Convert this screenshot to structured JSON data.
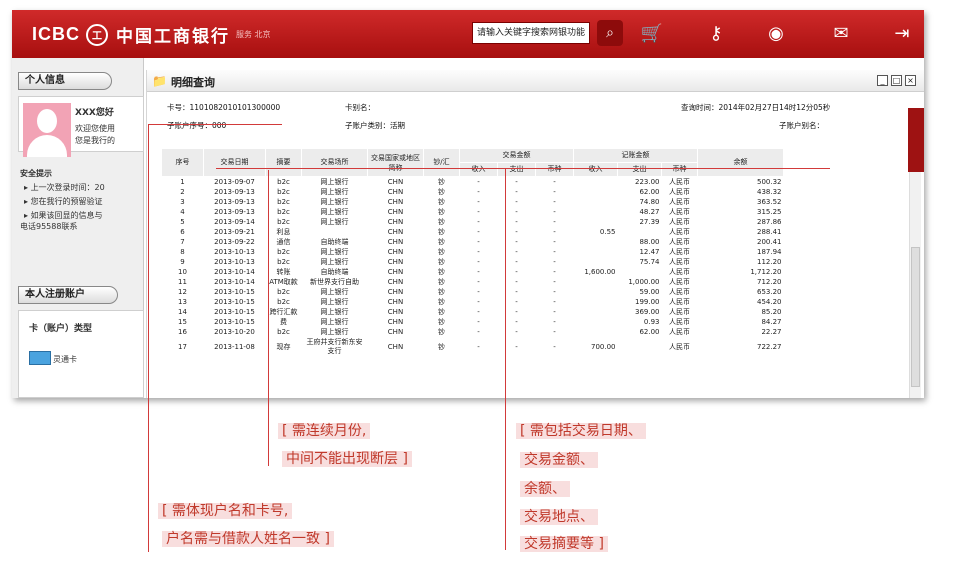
{
  "header": {
    "logo_en": "ICBC",
    "logo_seal": "工",
    "logo_cn": "中国工商银行",
    "logo_sub": "服务  北京",
    "search_value": "请输入关键字搜索网银功能",
    "icons": [
      "search-icon",
      "cart-icon",
      "key-icon",
      "disc-icon",
      "mail-icon",
      "exit-icon"
    ]
  },
  "sidebar": {
    "personal_title": "个人信息",
    "name": "XXX您好",
    "welcome1": "欢迎您使用",
    "welcome2": "您是我行的",
    "security_title": "安全提示",
    "tip1": "上一次登录时间：20",
    "tip2": "您在我行的预留验证",
    "tip3": "如果该回显的信息与",
    "tip4": "电话95588联系",
    "accounts_title": "本人注册账户",
    "card_type": "卡（账户）类型",
    "card_name": "灵通卡"
  },
  "main": {
    "title": "明细查询",
    "card_label": "卡号：",
    "card_no": "1101082010101300000",
    "alias_label": "卡别名：",
    "query_time": "查询时间：2014年02月27日14时12分05秒",
    "sub_no": "子账户序号：000",
    "sub_type": "子账户类别：活期",
    "sub_alias": "子账户别名：",
    "headers": {
      "seq": "序号",
      "date": "交易日期",
      "summary": "摘要",
      "place": "交易场所",
      "region": "交易国家或地区简称",
      "cash": "钞/汇",
      "amount": "交易金额",
      "record": "记账金额",
      "balance": "余额",
      "in": "收入",
      "out": "支出",
      "cur": "币种"
    },
    "rows": [
      [
        "1",
        "2013-09-07",
        "b2c",
        "网上银行",
        "CHN",
        "钞",
        "-",
        "-",
        "-",
        "",
        "223.00",
        "人民币",
        "500.32"
      ],
      [
        "2",
        "2013-09-13",
        "b2c",
        "网上银行",
        "CHN",
        "钞",
        "-",
        "-",
        "-",
        "",
        "62.00",
        "人民币",
        "438.32"
      ],
      [
        "3",
        "2013-09-13",
        "b2c",
        "网上银行",
        "CHN",
        "钞",
        "-",
        "-",
        "-",
        "",
        "74.80",
        "人民币",
        "363.52"
      ],
      [
        "4",
        "2013-09-13",
        "b2c",
        "网上银行",
        "CHN",
        "钞",
        "-",
        "-",
        "-",
        "",
        "48.27",
        "人民币",
        "315.25"
      ],
      [
        "5",
        "2013-09-14",
        "b2c",
        "网上银行",
        "CHN",
        "钞",
        "-",
        "-",
        "-",
        "",
        "27.39",
        "人民币",
        "287.86"
      ],
      [
        "6",
        "2013-09-21",
        "利息",
        "",
        "CHN",
        "钞",
        "-",
        "-",
        "-",
        "0.55",
        "",
        "人民币",
        "288.41"
      ],
      [
        "7",
        "2013-09-22",
        "通信",
        "自助终端",
        "CHN",
        "钞",
        "-",
        "-",
        "-",
        "",
        "88.00",
        "人民币",
        "200.41"
      ],
      [
        "8",
        "2013-10-13",
        "b2c",
        "网上银行",
        "CHN",
        "钞",
        "-",
        "-",
        "-",
        "",
        "12.47",
        "人民币",
        "187.94"
      ],
      [
        "9",
        "2013-10-13",
        "b2c",
        "网上银行",
        "CHN",
        "钞",
        "-",
        "-",
        "-",
        "",
        "75.74",
        "人民币",
        "112.20"
      ],
      [
        "10",
        "2013-10-14",
        "转账",
        "自助终端",
        "CHN",
        "钞",
        "-",
        "-",
        "-",
        "1,600.00",
        "",
        "人民币",
        "1,712.20"
      ],
      [
        "11",
        "2013-10-14",
        "ATM取款",
        "新世界支行自助",
        "CHN",
        "钞",
        "-",
        "-",
        "-",
        "",
        "1,000.00",
        "人民币",
        "712.20"
      ],
      [
        "12",
        "2013-10-15",
        "b2c",
        "网上银行",
        "CHN",
        "钞",
        "-",
        "-",
        "-",
        "",
        "59.00",
        "人民币",
        "653.20"
      ],
      [
        "13",
        "2013-10-15",
        "b2c",
        "网上银行",
        "CHN",
        "钞",
        "-",
        "-",
        "-",
        "",
        "199.00",
        "人民币",
        "454.20"
      ],
      [
        "14",
        "2013-10-15",
        "跨行汇款",
        "网上银行",
        "CHN",
        "钞",
        "-",
        "-",
        "-",
        "",
        "369.00",
        "人民币",
        "85.20"
      ],
      [
        "15",
        "2013-10-15",
        "费",
        "网上银行",
        "CHN",
        "钞",
        "-",
        "-",
        "-",
        "",
        "0.93",
        "人民币",
        "84.27"
      ],
      [
        "16",
        "2013-10-20",
        "b2c",
        "网上银行",
        "CHN",
        "钞",
        "-",
        "-",
        "-",
        "",
        "62.00",
        "人民币",
        "22.27"
      ],
      [
        "17",
        "2013-11-08",
        "现存",
        "王府井支行新东安支行",
        "CHN",
        "钞",
        "-",
        "-",
        "-",
        "700.00",
        "",
        "人民币",
        "722.27"
      ]
    ]
  },
  "annotations": {
    "a1_l1": "[ 需连续月份,",
    "a1_l2": "中间不能出现断层 ]",
    "a2_l1": "[ 需体现户名和卡号,",
    "a2_l2": "户名需与借款人姓名一致 ]",
    "a3_l1": "[ 需包括交易日期、",
    "a3_l2": "交易金额、",
    "a3_l3": "余额、",
    "a3_l4": "交易地点、",
    "a3_l5": "交易摘要等 ]"
  }
}
